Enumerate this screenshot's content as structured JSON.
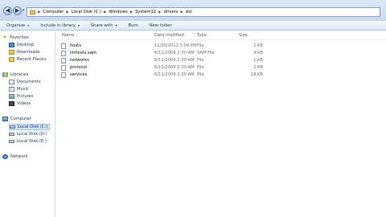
{
  "nav": {
    "back_glyph": "◀",
    "forward_glyph": "▶",
    "recent_glyph": "▾",
    "back_icon": "back-arrow-icon",
    "forward_icon": "forward-arrow-icon"
  },
  "address": {
    "folder_icon": "folder-icon",
    "separator_glyph": "▶",
    "crumbs": [
      {
        "label": "Computer"
      },
      {
        "label": "Local Disk (C:)"
      },
      {
        "label": "Windows"
      },
      {
        "label": "System32"
      },
      {
        "label": "drivers"
      },
      {
        "label": "etc"
      }
    ]
  },
  "toolbar": {
    "dropdown_glyph": "▾",
    "items": [
      {
        "label": "Organize",
        "has_dropdown": true
      },
      {
        "label": "Include in library",
        "has_dropdown": true
      },
      {
        "label": "Share with",
        "has_dropdown": true
      },
      {
        "label": "Burn",
        "has_dropdown": false
      },
      {
        "label": "New folder",
        "has_dropdown": false
      }
    ]
  },
  "sidebar": {
    "favorites": {
      "label": "Favorites",
      "icon": "star-icon",
      "glyph": "★"
    },
    "favorite_items": [
      {
        "label": "Desktop",
        "icon": "desktop-icon"
      },
      {
        "label": "Downloads",
        "icon": "downloads-icon"
      },
      {
        "label": "Recent Places",
        "icon": "recent-places-icon"
      }
    ],
    "libraries": {
      "label": "Libraries",
      "icon": "libraries-icon"
    },
    "library_items": [
      {
        "label": "Documents",
        "icon": "documents-icon"
      },
      {
        "label": "Music",
        "icon": "music-icon",
        "glyph": "♪"
      },
      {
        "label": "Pictures",
        "icon": "pictures-icon"
      },
      {
        "label": "Videos",
        "icon": "videos-icon"
      }
    ],
    "computer": {
      "label": "Computer",
      "icon": "computer-icon"
    },
    "computer_items": [
      {
        "label": "Local Disk (C:)",
        "icon": "drive-icon",
        "selected": true
      },
      {
        "label": "Local Disk (D:)",
        "icon": "drive-icon",
        "selected": false
      },
      {
        "label": "Local Disk (E:)",
        "icon": "drive-icon",
        "selected": false
      }
    ],
    "network": {
      "label": "Network",
      "icon": "network-icon"
    }
  },
  "file_list": {
    "headers": {
      "name": "Name",
      "date": "Date modified",
      "type": "Type",
      "size": "Size"
    },
    "files": [
      {
        "name": "hosts",
        "date": "11/30/2012 3:04 PM",
        "type": "File",
        "size": "1 KB"
      },
      {
        "name": "lmhosts.sam",
        "date": "6/11/2009 2:30 AM",
        "type": "SAM File",
        "size": "4 KB"
      },
      {
        "name": "networks",
        "date": "6/11/2009 2:30 AM",
        "type": "File",
        "size": "1 KB"
      },
      {
        "name": "protocol",
        "date": "6/11/2009 2:30 AM",
        "type": "File",
        "size": "2 KB"
      },
      {
        "name": "services",
        "date": "6/11/2009 2:30 AM",
        "type": "File",
        "size": "18 KB"
      }
    ]
  },
  "colors": {
    "titlebar": "#dbe7f6",
    "toolbar": "#e6eef8",
    "selection": "#cde4fb",
    "text_primary": "#1e395b",
    "text_secondary": "#6d6d6d"
  }
}
